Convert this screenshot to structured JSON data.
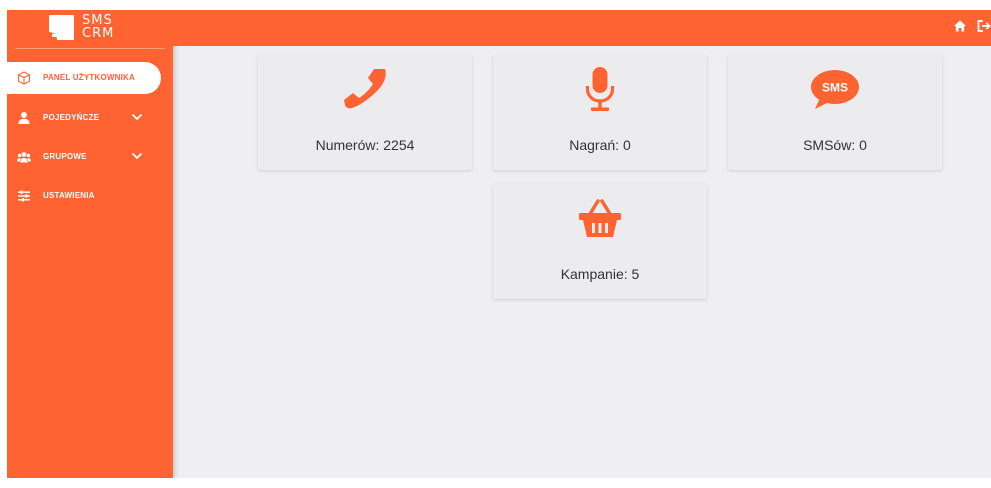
{
  "brand": {
    "line1": "SMS",
    "line2": "CRM"
  },
  "sidebar": {
    "items": [
      {
        "label": "PANEL UŻYTKOWNIKA",
        "active": true,
        "icon": "cube-icon"
      },
      {
        "label": "POJEDYŃCZE",
        "icon": "user-icon",
        "expandable": true
      },
      {
        "label": "GRUPOWE",
        "icon": "users-icon",
        "expandable": true
      },
      {
        "label": "USTAWIENIA",
        "icon": "sliders-icon"
      }
    ]
  },
  "topbar": {
    "icons": [
      "home-icon",
      "sign-out-icon"
    ]
  },
  "stats": [
    {
      "label": "Numerów: 2254",
      "icon": "phone-icon"
    },
    {
      "label": "Nagrań: 0",
      "icon": "microphone-icon"
    },
    {
      "label": "SMSów: 0",
      "icon": "sms-bubble-icon",
      "icon_text": "SMS"
    },
    {
      "label": "Kampanie: 5",
      "icon": "basket-icon"
    }
  ],
  "colors": {
    "accent": "#ff6331",
    "background": "#efeff1",
    "card": "#ececee",
    "text": "#333333"
  }
}
